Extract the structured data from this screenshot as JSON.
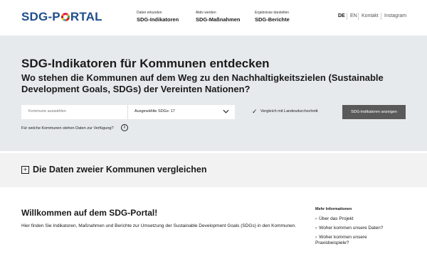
{
  "header": {
    "logo_left": "SDG-P",
    "logo_right": "RTAL",
    "nav": [
      {
        "small": "Daten erkunden",
        "big": "SDG-Indikatoren"
      },
      {
        "small": "Aktiv werden",
        "big": "SDG-Maßnahmen"
      },
      {
        "small": "Ergebnisse darstellen",
        "big": "SDG-Berichte"
      }
    ],
    "lang_de": "DE",
    "lang_en": "EN",
    "contact": "Kontakt",
    "instagram": "Instagram"
  },
  "hero": {
    "title": "SDG-Indikatoren für Kommunen entdecken",
    "subtitle": "Wo stehen die Kommunen auf dem Weg zu den Nachhaltigkeitszielen (Sustainable Development Goals, SDGs) der Vereinten Nationen?",
    "commune_placeholder": "Kommune auswählen",
    "sdg_select": "Ausgewählte SDGs: 17",
    "compare_checkbox": "Vergleich mit Landesdurchschnitt",
    "show_button": "SDG-Indikatoren anzeigen",
    "availability_link": "Für welche Kommunen stehen Daten zur Verfügung?"
  },
  "compare": {
    "title": "Die Daten zweier Kommunen vergleichen"
  },
  "main": {
    "welcome_title": "Willkommen auf dem SDG-Portal!",
    "intro": "Hier finden Sie Indikatoren, Maßnahmen und Berichte zur Umsetzung der Sustainable Development Goals (SDGs) in den Kommunen."
  },
  "more_info": {
    "title": "Mehr Informationen",
    "links": [
      "Über das Projekt",
      "Woher kommen unsere Daten?",
      "Woher kommen unsere Praxisbeispiele?"
    ]
  },
  "colors": {
    "brand_blue": "#1f4e8c",
    "hero_bg": "#e7eaed",
    "button_bg": "#5a5a5a"
  }
}
